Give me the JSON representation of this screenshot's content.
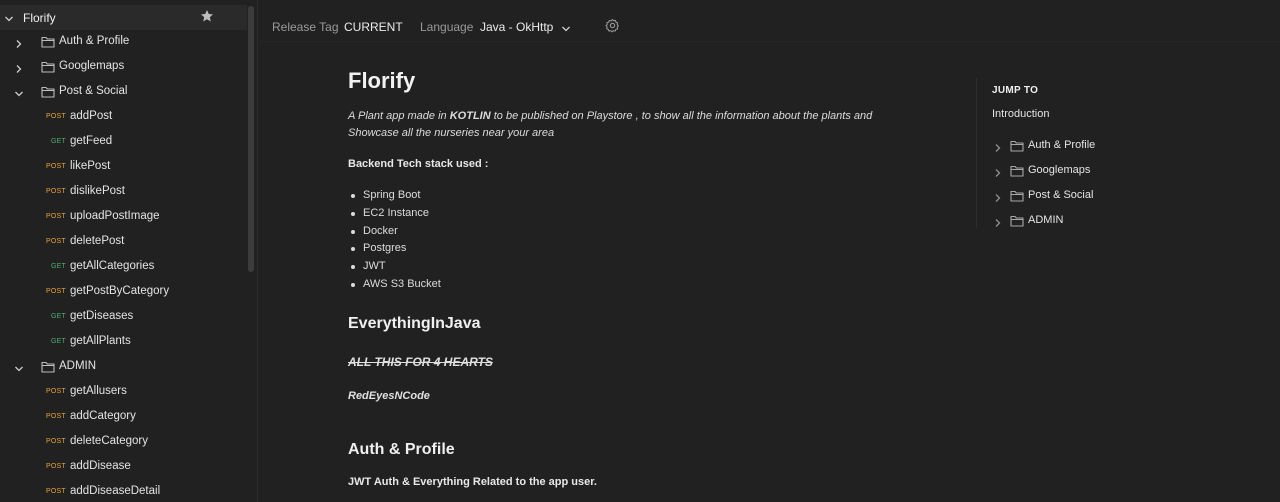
{
  "sidebar": {
    "collection": "Florify",
    "rows": [
      {
        "type": "folder",
        "label": "Auth & Profile",
        "expanded": false
      },
      {
        "type": "folder",
        "label": "Googlemaps",
        "expanded": false
      },
      {
        "type": "folder",
        "label": "Post & Social",
        "expanded": true
      },
      {
        "type": "request",
        "method": "POST",
        "label": "addPost"
      },
      {
        "type": "request",
        "method": "GET",
        "label": "getFeed"
      },
      {
        "type": "request",
        "method": "POST",
        "label": "likePost"
      },
      {
        "type": "request",
        "method": "POST",
        "label": "dislikePost"
      },
      {
        "type": "request",
        "method": "POST",
        "label": "uploadPostImage"
      },
      {
        "type": "request",
        "method": "POST",
        "label": "deletePost"
      },
      {
        "type": "request",
        "method": "GET",
        "label": "getAllCategories"
      },
      {
        "type": "request",
        "method": "POST",
        "label": "getPostByCategory"
      },
      {
        "type": "request",
        "method": "GET",
        "label": "getDiseases"
      },
      {
        "type": "request",
        "method": "GET",
        "label": "getAllPlants"
      },
      {
        "type": "folder",
        "label": "ADMIN",
        "expanded": true
      },
      {
        "type": "request",
        "method": "POST",
        "label": "getAllusers"
      },
      {
        "type": "request",
        "method": "POST",
        "label": "addCategory"
      },
      {
        "type": "request",
        "method": "POST",
        "label": "deleteCategory"
      },
      {
        "type": "request",
        "method": "POST",
        "label": "addDisease"
      },
      {
        "type": "request",
        "method": "POST",
        "label": "addDiseaseDetail"
      }
    ]
  },
  "topbar": {
    "release_label": "Release Tag",
    "release_value": "CURRENT",
    "language_label": "Language",
    "language_value": "Java - OkHttp"
  },
  "doc": {
    "title": "Florify",
    "intro_prefix": "A Plant app made in ",
    "intro_bold": "KOTLIN",
    "intro_suffix": " to be published on Playstore , to show all the information about the plants and Showcase all the nurseries near your area",
    "stack_heading": "Backend Tech stack used :",
    "stack": [
      "Spring Boot",
      "EC2 Instance",
      "Docker",
      "Postgres",
      "JWT",
      "AWS S3 Bucket"
    ],
    "heading2": "EverythingInJava",
    "strike_text": "ALL THIS FOR 4 HEARTS",
    "signature": "RedEyesNCode",
    "section_title": "Auth & Profile",
    "section_desc": "JWT Auth & Everything Related to the app user."
  },
  "jump": {
    "title": "JUMP TO",
    "intro": "Introduction",
    "folders": [
      "Auth & Profile",
      "Googlemaps",
      "Post & Social",
      "ADMIN"
    ]
  },
  "colors": {
    "post": "#e6a33e",
    "get": "#4caf70",
    "background": "#212121"
  }
}
